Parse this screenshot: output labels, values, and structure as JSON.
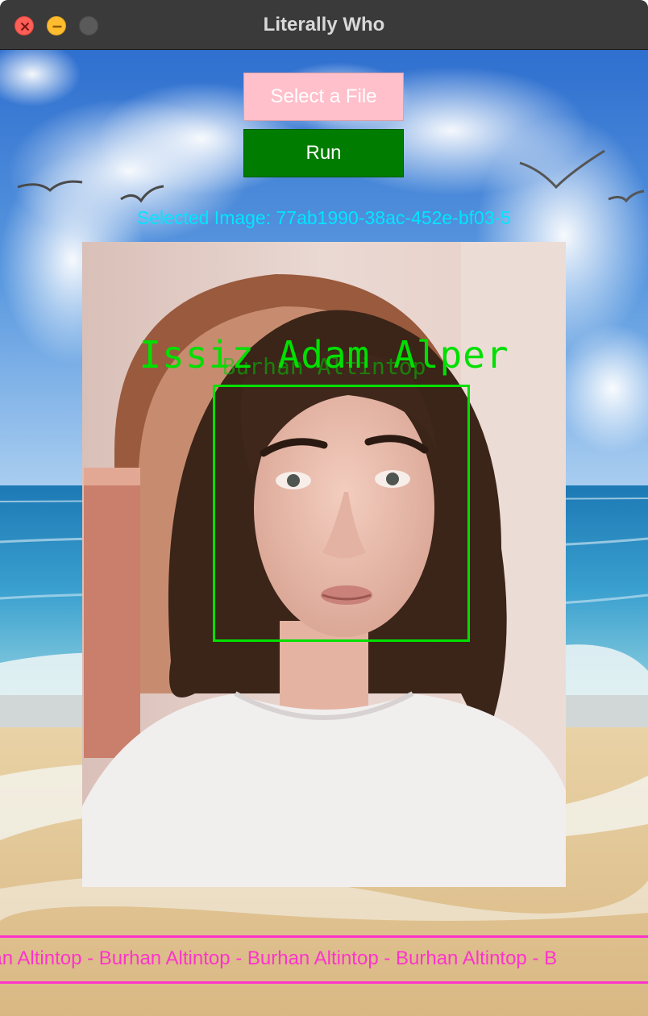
{
  "window": {
    "title": "Literally Who",
    "controls": [
      "close-icon",
      "minimize-icon",
      "zoom-icon"
    ]
  },
  "toolbar": {
    "select_file_label": "Select a File",
    "run_label": "Run"
  },
  "selected_image_text": "Selected Image: 77ab1990-38ac-452e-bf03-5",
  "detection": {
    "primary_label": "Issiz Adam Alper",
    "secondary_label": "Burhan Altintop",
    "box_color": "#00e000"
  },
  "marquee": {
    "text": "han Altintop - Burhan Altintop - Burhan Altintop - Burhan Altintop - B",
    "color": "#ff33cc"
  },
  "colors": {
    "select_file_bg": "#ffc0cb",
    "run_bg": "#007d00",
    "selected_text": "#00e6ff"
  }
}
